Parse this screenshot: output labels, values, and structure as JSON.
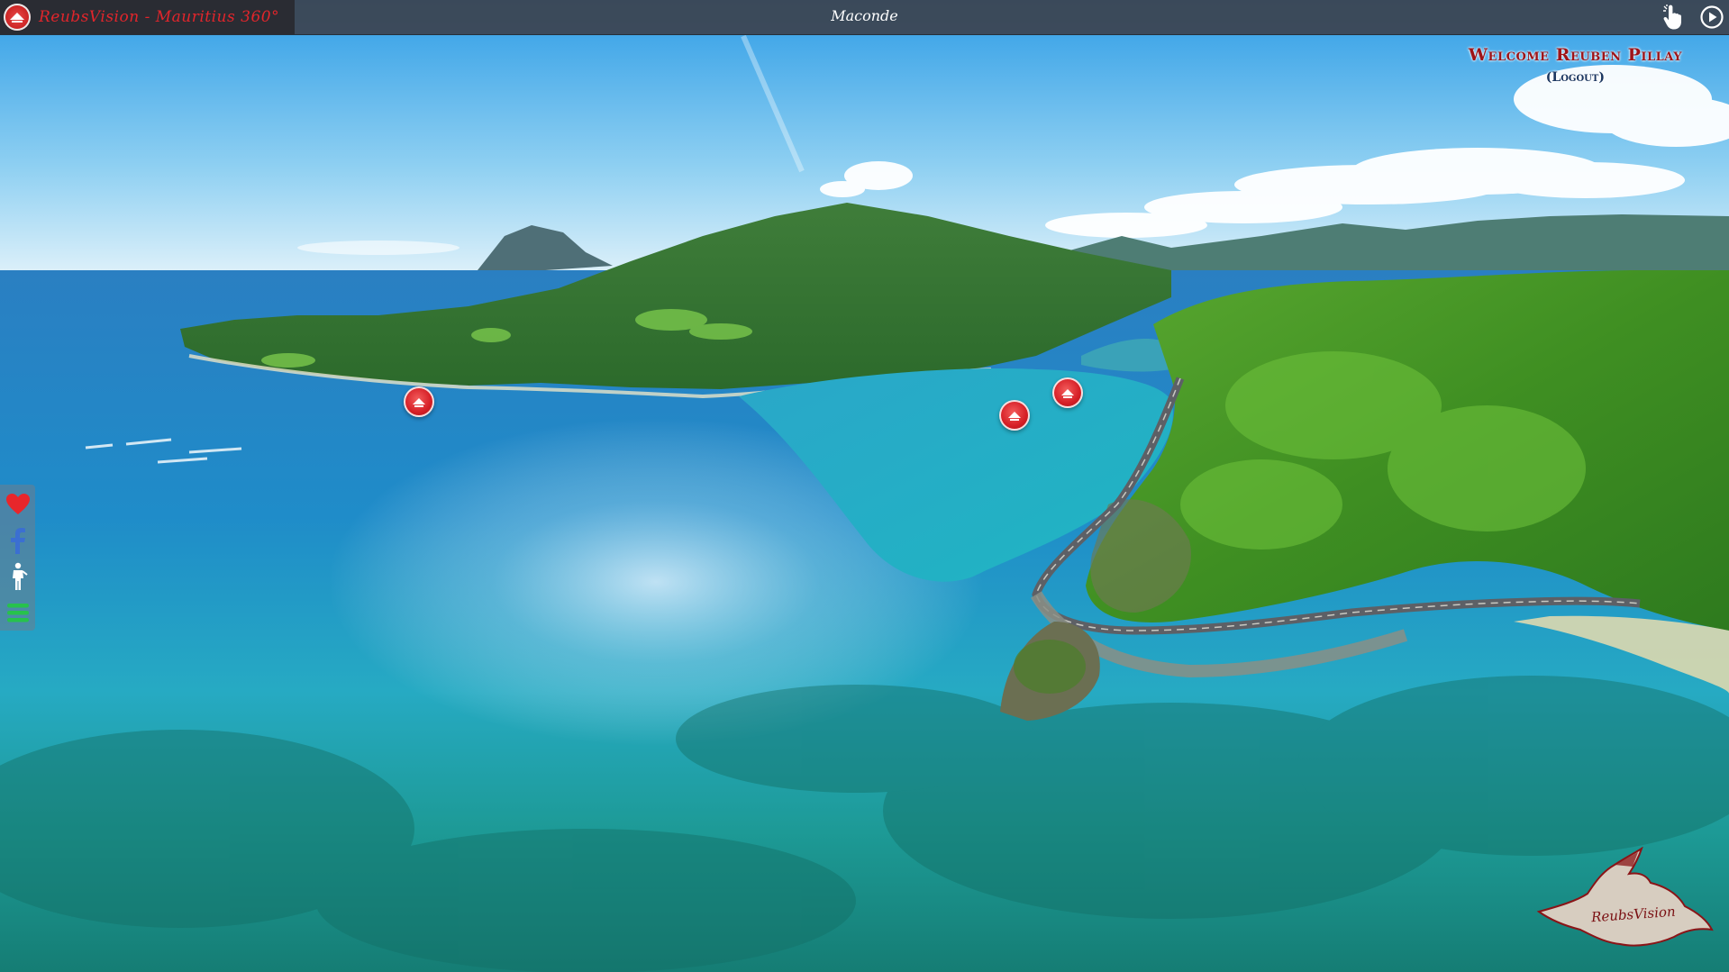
{
  "topbar": {
    "brand_title": "ReubsVision - Mauritius 360°",
    "scene_title": "Maconde"
  },
  "welcome": {
    "text": "Welcome Reuben Pillay",
    "logout": "(Logout)"
  },
  "side_toolbar": {
    "items": [
      {
        "name": "favorite",
        "icon": "heart-icon",
        "color": "#e8262b"
      },
      {
        "name": "facebook",
        "icon": "facebook-icon",
        "color": "#3b6fd1"
      },
      {
        "name": "walk-mode",
        "icon": "person-icon",
        "color": "#ffffff"
      },
      {
        "name": "menu",
        "icon": "hamburger-icon",
        "color": "#27c24c"
      }
    ]
  },
  "topbar_buttons": [
    {
      "name": "gyroscope",
      "icon": "hand-touch-icon"
    },
    {
      "name": "autoplay",
      "icon": "play-icon"
    }
  ],
  "hotspots": [
    {
      "name": "hotspot-1"
    },
    {
      "name": "hotspot-2"
    },
    {
      "name": "hotspot-3"
    }
  ],
  "watermark": {
    "text": "ReubsVision"
  },
  "colors": {
    "accent_red": "#d61f26",
    "welcome_red": "#9e1418",
    "logout_blue": "#1b3660",
    "topbar_bg": "#3c424e"
  }
}
